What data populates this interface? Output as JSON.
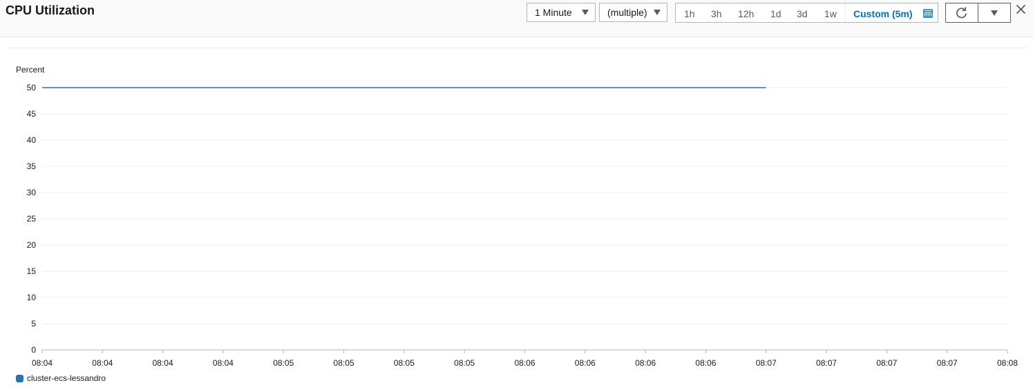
{
  "widget": {
    "title": "CPU Utilization",
    "period": "1 Minute",
    "statistic": "(multiple)",
    "ranges": [
      "1h",
      "3h",
      "12h",
      "1d",
      "3d",
      "1w"
    ],
    "custom_range": "Custom (5m)"
  },
  "colors": {
    "series": "#1f77b4",
    "accent": "#0073bb",
    "grid": "#eaeded"
  },
  "icons": {
    "calendar": "calendar-icon",
    "refresh": "refresh-icon",
    "menu": "chevron-down-icon",
    "close": "close-icon"
  },
  "chart_data": {
    "type": "line",
    "ylabel": "Percent",
    "ylim": [
      0,
      50
    ],
    "yticks": [
      "0",
      "5",
      "10",
      "15",
      "20",
      "25",
      "30",
      "35",
      "40",
      "45",
      "50"
    ],
    "xticks": [
      "08:04",
      "08:04",
      "08:04",
      "08:04",
      "08:05",
      "08:05",
      "08:05",
      "08:05",
      "08:06",
      "08:06",
      "08:06",
      "08:06",
      "08:07",
      "08:07",
      "08:07",
      "08:07",
      "08:08"
    ],
    "grid": "horizontal",
    "legend_position": "bottom-left",
    "series": [
      {
        "name": "cluster-ecs-lessandro",
        "color": "#1f77b4",
        "x_index": [
          0,
          12
        ],
        "values": [
          50,
          50
        ]
      }
    ]
  }
}
